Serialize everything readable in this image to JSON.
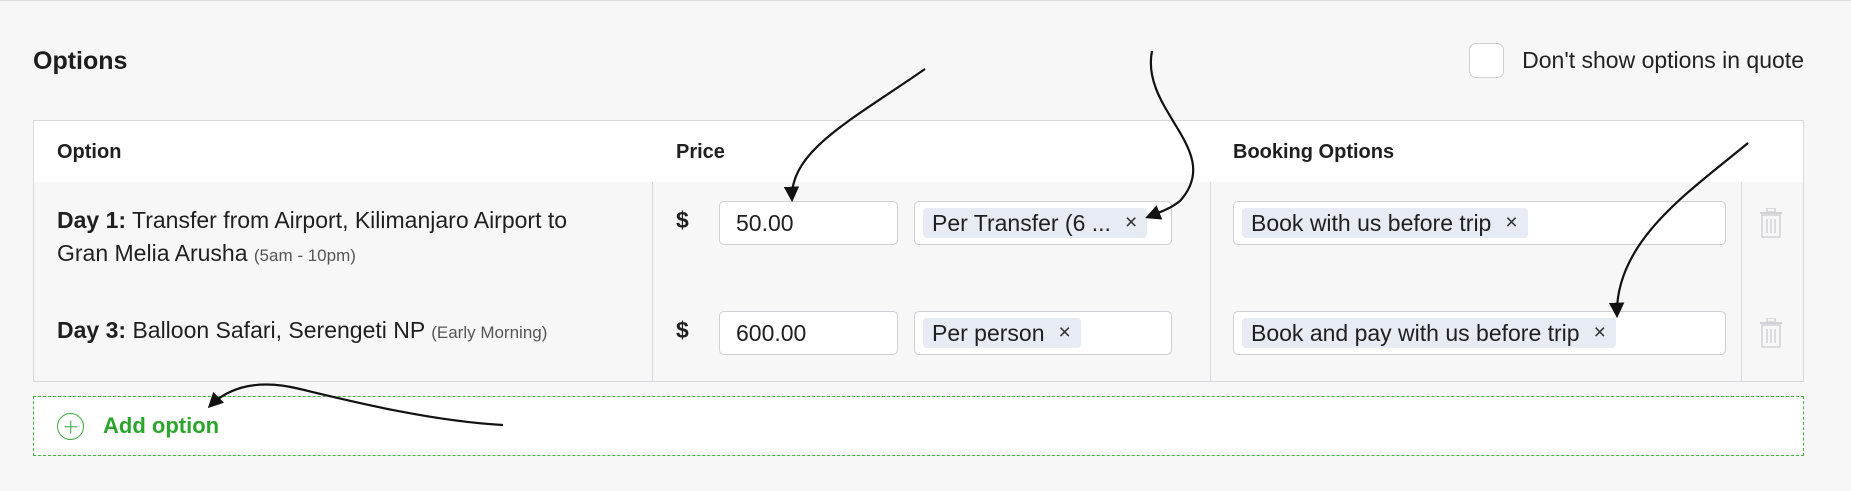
{
  "section": {
    "title": "Options"
  },
  "dont_show": {
    "label": "Don't show options in quote",
    "checked": false
  },
  "table": {
    "headers": {
      "option": "Option",
      "price": "Price",
      "booking": "Booking Options"
    },
    "rows": [
      {
        "day": "Day 1:",
        "name_line1": "Transfer from Airport, Kilimanjaro Airport to",
        "name_line2": "Gran Melia Arusha",
        "time": "(5am - 10pm)",
        "currency": "$",
        "price": "50.00",
        "price_type": "Per Transfer (6 ...",
        "booking_option": "Book with us before trip"
      },
      {
        "day": "Day 3:",
        "name_line1": "Balloon Safari, Serengeti NP",
        "time": "(Early Morning)",
        "currency": "$",
        "price": "600.00",
        "price_type": "Per person",
        "booking_option": "Book and pay with us before trip"
      }
    ]
  },
  "add_option": {
    "label": "Add option"
  },
  "colors": {
    "accent_green": "#2ca52c",
    "chip_bg": "#e7ebf4"
  },
  "icons": {
    "remove": "×",
    "delete": "trash-icon",
    "add": "plus-circle-icon"
  }
}
